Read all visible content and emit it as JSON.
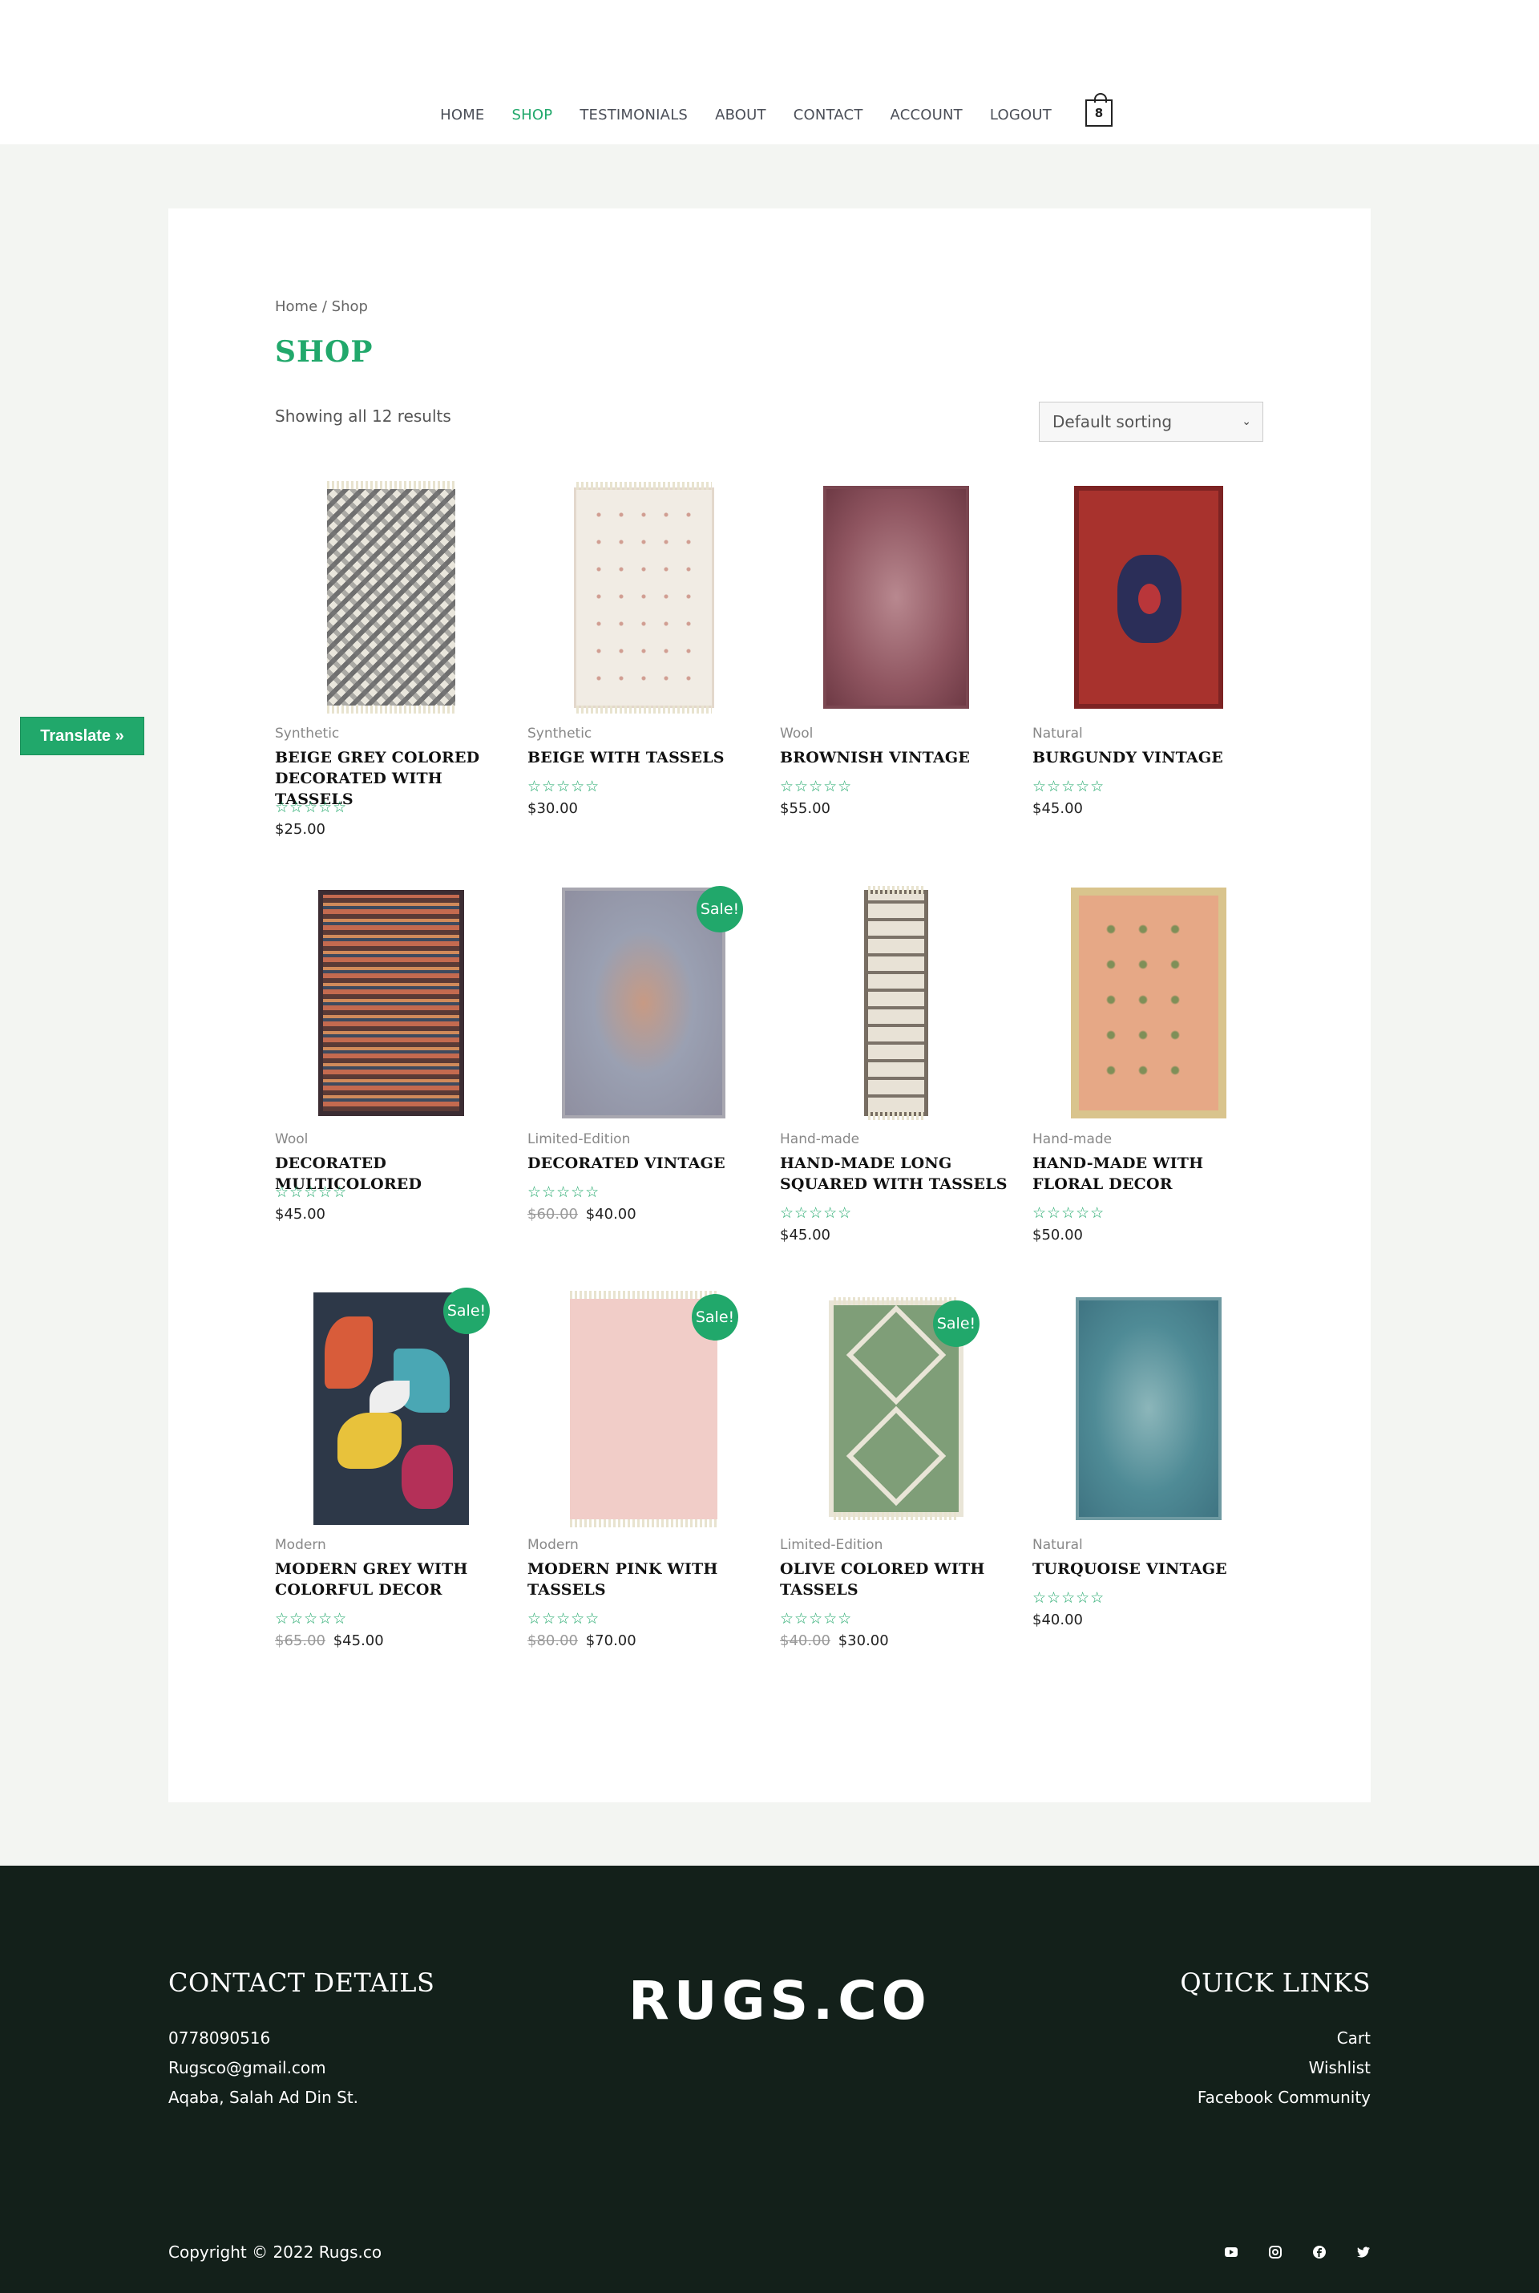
{
  "nav": {
    "items": [
      "HOME",
      "SHOP",
      "TESTIMONIALS",
      "ABOUT",
      "CONTACT",
      "ACCOUNT",
      "LOGOUT"
    ],
    "active": "SHOP",
    "cart_count": "8"
  },
  "breadcrumb": "Home / Shop",
  "page_title": "SHOP",
  "results_text": "Showing all 12 results",
  "sort": {
    "selected": "Default sorting"
  },
  "stars": "☆☆☆☆☆",
  "sale_label": "Sale!",
  "translate_label": "Translate »",
  "products": [
    {
      "category": "Synthetic",
      "name": "BEIGE GREY COLORED DECORATED WITH TASSELS",
      "price": "$25.00",
      "old_price": "",
      "sale": false
    },
    {
      "category": "Synthetic",
      "name": "BEIGE WITH TASSELS",
      "price": "$30.00",
      "old_price": "",
      "sale": false
    },
    {
      "category": "Wool",
      "name": "BROWNISH VINTAGE",
      "price": "$55.00",
      "old_price": "",
      "sale": false
    },
    {
      "category": "Natural",
      "name": "BURGUNDY VINTAGE",
      "price": "$45.00",
      "old_price": "",
      "sale": false
    },
    {
      "category": "Wool",
      "name": "DECORATED MULTICOLORED",
      "price": "$45.00",
      "old_price": "",
      "sale": false
    },
    {
      "category": "Limited-Edition",
      "name": "DECORATED VINTAGE",
      "price": "$40.00",
      "old_price": "$60.00",
      "sale": true
    },
    {
      "category": "Hand-made",
      "name": "HAND-MADE LONG SQUARED WITH TASSELS",
      "price": "$45.00",
      "old_price": "",
      "sale": false
    },
    {
      "category": "Hand-made",
      "name": "HAND-MADE WITH FLORAL DECOR",
      "price": "$50.00",
      "old_price": "",
      "sale": false
    },
    {
      "category": "Modern",
      "name": "MODERN GREY WITH COLORFUL DECOR",
      "price": "$45.00",
      "old_price": "$65.00",
      "sale": true
    },
    {
      "category": "Modern",
      "name": "MODERN PINK WITH TASSELS",
      "price": "$70.00",
      "old_price": "$80.00",
      "sale": true
    },
    {
      "category": "Limited-Edition",
      "name": "OLIVE COLORED WITH TASSELS",
      "price": "$30.00",
      "old_price": "$40.00",
      "sale": true
    },
    {
      "category": "Natural",
      "name": "TURQUOISE VINTAGE",
      "price": "$40.00",
      "old_price": "",
      "sale": false
    }
  ],
  "footer": {
    "contact_heading": "CONTACT DETAILS",
    "phone": "0778090516",
    "email": "Rugsco@gmail.com",
    "address": "Aqaba, Salah Ad Din St.",
    "logo_text": "RUGS.CO",
    "links_heading": "QUICK LINKS",
    "links": [
      "Cart",
      "Wishlist",
      "Facebook Community"
    ],
    "copyright": "Copyright © 2022 Rugs.co",
    "social_icons": [
      "youtube-icon",
      "instagram-icon",
      "facebook-icon",
      "twitter-icon"
    ]
  },
  "colors": {
    "accent": "#21a86b",
    "footer_bg": "#13201a",
    "page_bg": "#f3f5f2"
  }
}
